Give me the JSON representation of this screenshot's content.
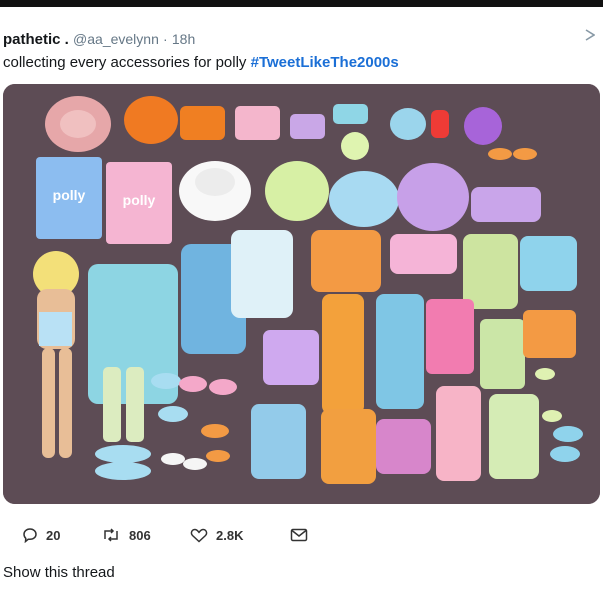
{
  "tweet": {
    "display_name": "pathetic .",
    "handle": "@aa_evelynn",
    "separator": "·",
    "time": "18h",
    "text": "collecting every accessories for polly ",
    "hashtag": "#TweetLikeThe2000s"
  },
  "photo": {
    "bag_labels": [
      "polly",
      "polly"
    ]
  },
  "actions": {
    "replies": "20",
    "retweets": "806",
    "likes": "2.8K"
  },
  "show_thread": "Show this thread",
  "colors": {
    "hashtag": "#1b6fd6",
    "photo_background": "#5d4c55",
    "muted_text": "#657786"
  },
  "icons": [
    "chevron-down-icon",
    "reply-icon",
    "retweet-icon",
    "like-icon",
    "message-icon"
  ]
}
